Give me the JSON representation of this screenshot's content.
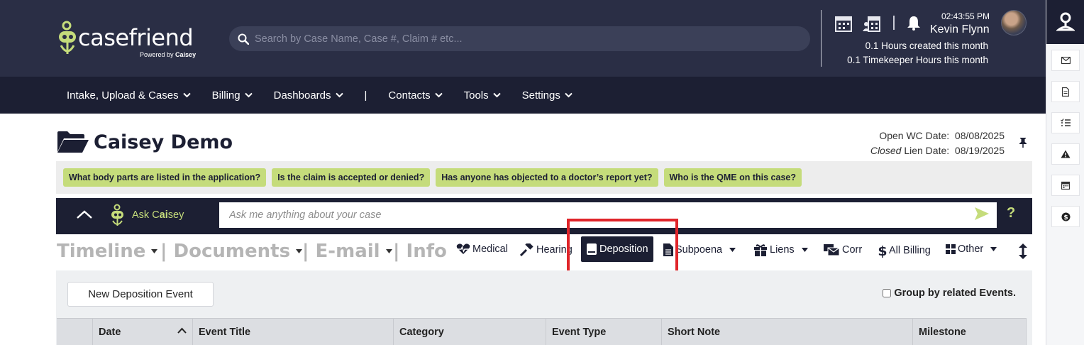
{
  "brand": {
    "name": "casefriend",
    "powered_by": "Powered by",
    "powered_brand": "Caisey"
  },
  "search": {
    "placeholder": "Search by Case Name, Case #, Claim # etc..."
  },
  "user": {
    "time": "02:43:55 PM",
    "name": "Kevin Flynn",
    "hours_created": "0.1 Hours created this month",
    "timekeeper_hours": "0.1 Timekeeper Hours this month"
  },
  "nav": {
    "items": [
      {
        "label": "Intake, Upload & Cases"
      },
      {
        "label": "Billing"
      },
      {
        "label": "Dashboards"
      }
    ],
    "separator": "|",
    "items2": [
      {
        "label": "Contacts"
      },
      {
        "label": "Tools"
      },
      {
        "label": "Settings"
      }
    ]
  },
  "case": {
    "title": "Caisey Demo",
    "open_label": "Open WC Date:",
    "open_date": "08/08/2025",
    "closed_prefix": "Closed",
    "closed_label": "Lien Date:",
    "closed_date": "08/19/2025"
  },
  "suggestions": [
    "What body parts are listed in the application?",
    "Is the claim is accepted or denied?",
    "Has anyone has objected to a doctor’s report yet?",
    "Who is the QME on this case?"
  ],
  "ask": {
    "label_prefix": "Ask C",
    "label_bold": "ai",
    "label_suffix": "sey",
    "placeholder": "Ask me anything about your case",
    "help": "?"
  },
  "tabs": {
    "big": [
      {
        "label": "Timeline"
      },
      {
        "label": "| Documents"
      },
      {
        "label": "| E-mail"
      },
      {
        "label": "| Info"
      }
    ],
    "small": [
      {
        "label": "Medical",
        "icon": "heartbeat-icon"
      },
      {
        "label": "Hearing",
        "icon": "gavel-icon"
      },
      {
        "label": "Deposition",
        "icon": "book-icon",
        "active": true
      },
      {
        "label": "Subpoena",
        "icon": "file-icon"
      },
      {
        "label": "Liens",
        "icon": "gift-icon"
      },
      {
        "label": "Corr",
        "icon": "envelope-icon"
      },
      {
        "label": "All Billing",
        "icon": "dollar-icon"
      },
      {
        "label": "Other",
        "icon": "grid-icon"
      }
    ]
  },
  "panel": {
    "new_button": "New Deposition Event",
    "group_label": "Group by related Events.",
    "columns": [
      "Date",
      "Event Title",
      "Category",
      "Event Type",
      "Short Note",
      "Milestone"
    ]
  },
  "colors": {
    "topbar": "#2a2e45",
    "navbar": "#1c1f33",
    "accent": "#c5dc7b",
    "highlight": "#e0252a"
  }
}
